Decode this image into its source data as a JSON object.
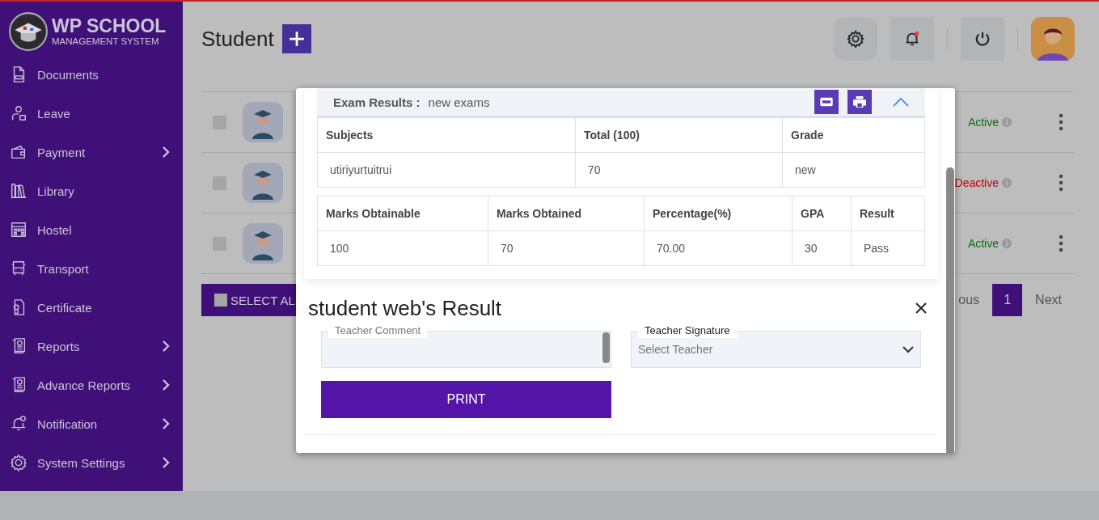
{
  "sidebar": {
    "logo": {
      "title": "WP SCHOOL",
      "subtitle": "MANAGEMENT SYSTEM"
    },
    "items": [
      {
        "label": "Documents",
        "kind": "document",
        "has_submenu": false
      },
      {
        "label": "Leave",
        "kind": "person",
        "has_submenu": false
      },
      {
        "label": "Payment",
        "kind": "wallet",
        "has_submenu": true
      },
      {
        "label": "Library",
        "kind": "books",
        "has_submenu": false
      },
      {
        "label": "Hostel",
        "kind": "building",
        "has_submenu": false
      },
      {
        "label": "Transport",
        "kind": "bus",
        "has_submenu": false
      },
      {
        "label": "Certificate",
        "kind": "certificate",
        "has_submenu": false
      },
      {
        "label": "Reports",
        "kind": "report",
        "has_submenu": true
      },
      {
        "label": "Advance Reports",
        "kind": "report",
        "has_submenu": true
      },
      {
        "label": "Notification",
        "kind": "bell",
        "has_submenu": true
      },
      {
        "label": "System Settings",
        "kind": "gear",
        "has_submenu": true
      }
    ]
  },
  "header": {
    "title": "Student"
  },
  "students": {
    "rows": [
      {
        "status": "Active",
        "kind": "active",
        "checked": false
      },
      {
        "status": "Deactive",
        "kind": "deactive",
        "checked": false
      },
      {
        "status": "Active",
        "kind": "active",
        "checked": false
      }
    ],
    "select_all": "SELECT AL",
    "pagination": {
      "previous": "ous",
      "pages": [
        {
          "label": "1",
          "selected": true
        }
      ],
      "next": "Next"
    }
  },
  "modal": {
    "exam_label": "Exam Results :",
    "exam_name": "new exams",
    "subjects_table": {
      "columns": [
        "Subjects",
        "Total (100)",
        "Grade"
      ],
      "rows": [
        [
          "utiriyurtuitrui",
          "70",
          "new"
        ]
      ]
    },
    "summary_table": {
      "columns": [
        "Marks Obtainable",
        "Marks Obtained",
        "Percentage(%)",
        "GPA",
        "Result"
      ],
      "rows": [
        [
          "100",
          "70",
          "70.00",
          "30",
          "Pass"
        ]
      ]
    },
    "title": "student web's Result",
    "comment_field": {
      "label": "Teacher Comment"
    },
    "signature_field": {
      "label": "Teacher Signature",
      "placeholder": "Select Teacher"
    },
    "print_button": "PRINT"
  }
}
